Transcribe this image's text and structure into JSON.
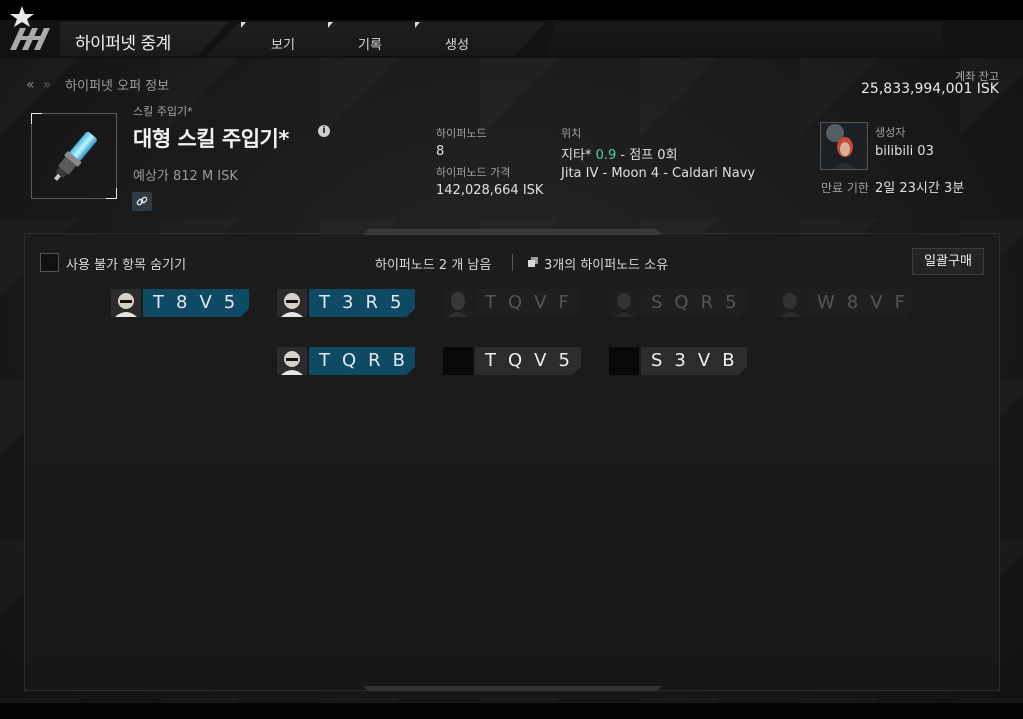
{
  "header": {
    "app_title": "하이퍼넷 중계",
    "tabs": [
      {
        "label": "보기"
      },
      {
        "label": "기록"
      },
      {
        "label": "생성"
      }
    ]
  },
  "breadcrumb": {
    "title": "하이퍼넷 오퍼 정보"
  },
  "account": {
    "balance_label": "계좌 잔고",
    "balance_value": "25,833,994,001 ISK"
  },
  "item": {
    "category": "스킬 주입기*",
    "name": "대형 스킬 주입기*",
    "info_glyph": "i",
    "estimated_price": "예상가 812 M ISK"
  },
  "offer": {
    "hypernode_label": "하이퍼노드",
    "hypernode_value": "8",
    "price_label": "하이퍼노드 가격",
    "price_value": "142,028,664 ISK",
    "location_label": "위치",
    "system_name": "지타*",
    "security_status": "0.9",
    "jump_text": "- 점프 0회",
    "station": "Jita IV - Moon 4 - Caldari Navy",
    "creator_label": "생성자",
    "creator_name": "bilibili 03",
    "expiry_label": "만료 기한",
    "expiry_value": "2일 23시간 3분"
  },
  "controls": {
    "hide_unavailable_label": "사용 불가 항목 숨기기",
    "remaining_text": "하이퍼노드 2 개 남음",
    "owned_text": "3개의 하이퍼노드 소유",
    "buy_all_label": "일괄구매"
  },
  "nodes": [
    {
      "code": "T8V5",
      "status": "mine"
    },
    {
      "code": "T3R5",
      "status": "mine"
    },
    {
      "code": "TQVF",
      "status": "taken"
    },
    {
      "code": "SQR5",
      "status": "taken"
    },
    {
      "code": "W8VF",
      "status": "taken"
    },
    {
      "code": "TQRB",
      "status": "mine"
    },
    {
      "code": "TQV5",
      "status": "available"
    },
    {
      "code": "S3VB",
      "status": "available"
    }
  ],
  "colors": {
    "accent": "#0e4a63",
    "security": "#4fd0a0",
    "background": "#1a1a1a"
  },
  "icons": [
    "hypernet-logo-icon",
    "double-chevron-left-icon",
    "double-chevron-right-icon",
    "info-icon",
    "link-icon",
    "skill-injector-icon",
    "nodes-owned-icon"
  ]
}
